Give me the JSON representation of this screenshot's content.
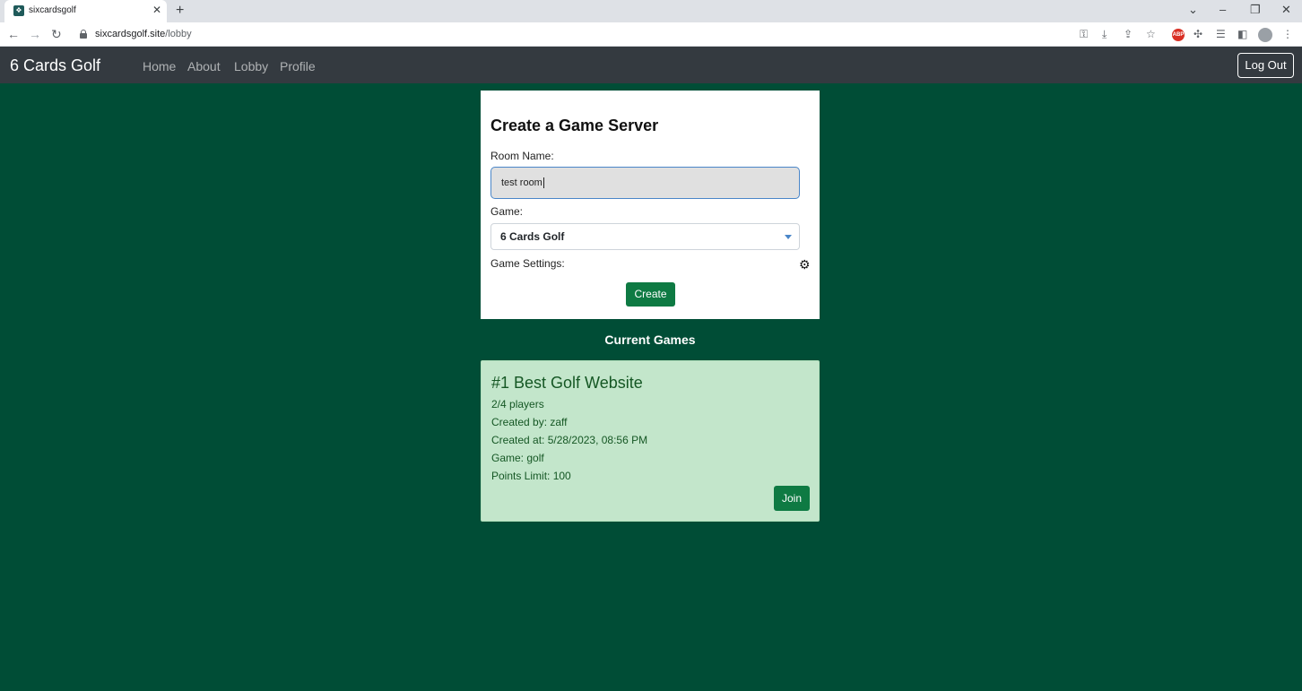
{
  "browser": {
    "tab_title": "sixcardsgolf",
    "url_host": "sixcardsgolf.site",
    "url_path": "/lobby",
    "icons": [
      "back-icon",
      "forward-icon",
      "reload-icon",
      "lock-icon",
      "key-icon",
      "install-icon",
      "share-icon",
      "star-icon",
      "adblock-icon",
      "extensions-icon",
      "reading-list-icon",
      "sidebar-icon",
      "profile-icon",
      "menu-icon"
    ]
  },
  "navbar": {
    "brand": "6 Cards Golf",
    "links": [
      "Home",
      "About",
      "Lobby",
      "Profile"
    ],
    "logout": "Log Out"
  },
  "create": {
    "title": "Create a Game Server",
    "room_label": "Room Name:",
    "room_value": "test room",
    "game_label": "Game:",
    "game_value": "6 Cards Golf",
    "settings_label": "Game Settings:",
    "button": "Create"
  },
  "current_games": {
    "heading": "Current Games",
    "games": [
      {
        "name": "#1 Best Golf Website",
        "players": "2/4 players",
        "created_by": "Created by: zaff",
        "created_at": "Created at: 5/28/2023, 08:56 PM",
        "game": "Game: golf",
        "points_limit": "Points Limit: 100",
        "join": "Join"
      }
    ]
  },
  "colors": {
    "background": "#004d36",
    "navbar": "#343a40",
    "button": "#0e7a43",
    "game_card": "#c3e6cb",
    "game_text": "#155724"
  }
}
